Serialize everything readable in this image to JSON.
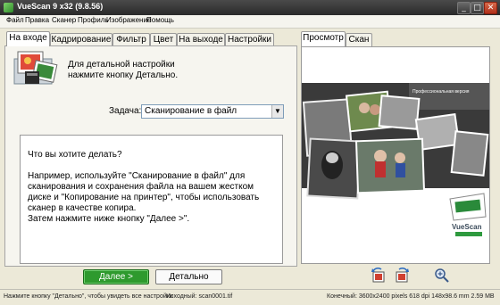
{
  "window": {
    "title": "VueScan 9 x32 (9.8.56)"
  },
  "menu": {
    "items": [
      "Файл",
      "Правка",
      "Сканер",
      "Профиль",
      "Изображение",
      "Помощь"
    ]
  },
  "left_tabs": [
    "На входе",
    "Кадрирование",
    "Фильтр",
    "Цвет",
    "На выходе",
    "Настройки"
  ],
  "active_left_tab": "На входе",
  "right_tabs": [
    "Просмотр",
    "Скан"
  ],
  "active_right_tab": "Просмотр",
  "hint": {
    "line1": "Для детальной настройки",
    "line2": "нажмите кнопку Детально."
  },
  "task": {
    "label": "Задача:",
    "value": "Сканирование в файл"
  },
  "help_text": {
    "p1": "Что вы хотите делать?",
    "p2": "Например, используйте \"Сканирование в файл\" для сканирования и сохранения файла на вашем жестком диске и \"Копирование на принтер\", чтобы использовать сканер в качестве копира.",
    "p3": "Затем нажмите ниже кнопку \"Далее >\"."
  },
  "buttons": {
    "next": "Далее >",
    "detail": "Детально"
  },
  "preview": {
    "banner_text": "Профессиональная версия",
    "brand": "VueScan"
  },
  "status": {
    "left": "Нажмите кнопку \"Детально\", чтобы увидеть все настройки",
    "source": "Исходный: scan0001.tif",
    "right": "Конечный: 3600x2400 pixels 618 dpi 148x98.6 mm 2.59 MB"
  }
}
